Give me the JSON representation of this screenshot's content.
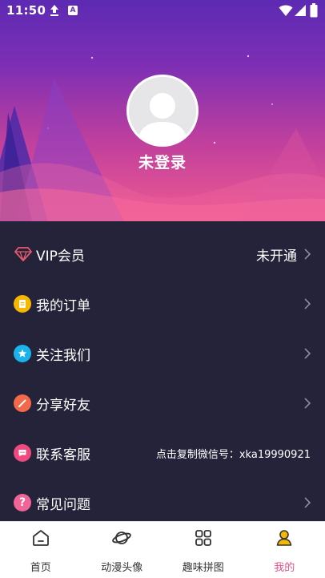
{
  "status_bar": {
    "time": "11:50",
    "upload_icon": "upload-arrow",
    "notification_icon": "a-box",
    "wifi_icon": "wifi",
    "signal_icon": "cell-signal",
    "battery_icon": "battery"
  },
  "profile": {
    "avatar_icon": "default-user-avatar",
    "login_status": "未登录"
  },
  "menu": {
    "items": [
      {
        "label": "VIP会员",
        "value": "未开通",
        "icon": "diamond-icon",
        "color": "#e85a6d"
      },
      {
        "label": "我的订单",
        "value": "",
        "icon": "order-icon",
        "color": "#f5b700"
      },
      {
        "label": "关注我们",
        "value": "",
        "icon": "star-icon",
        "color": "#1ab3ec"
      },
      {
        "label": "分享好友",
        "value": "",
        "icon": "share-icon",
        "color": "#f4694a"
      },
      {
        "label": "联系客服",
        "value": "点击复制微信号：xka19990921",
        "icon": "message-icon",
        "color": "#ef4a7f"
      },
      {
        "label": "常见问题",
        "value": "",
        "icon": "question-icon",
        "color": "#f06596"
      }
    ]
  },
  "tabbar": {
    "tabs": [
      {
        "label": "首页",
        "icon": "home-icon"
      },
      {
        "label": "动漫头像",
        "icon": "planet-icon"
      },
      {
        "label": "趣味拼图",
        "icon": "grid-icon"
      },
      {
        "label": "我的",
        "icon": "user-icon",
        "active": true
      }
    ],
    "active_color": "#e84f86"
  },
  "colors": {
    "header_top": "#5d2ab3",
    "header_bottom": "#ee5a8f",
    "list_background": "#24233a"
  }
}
